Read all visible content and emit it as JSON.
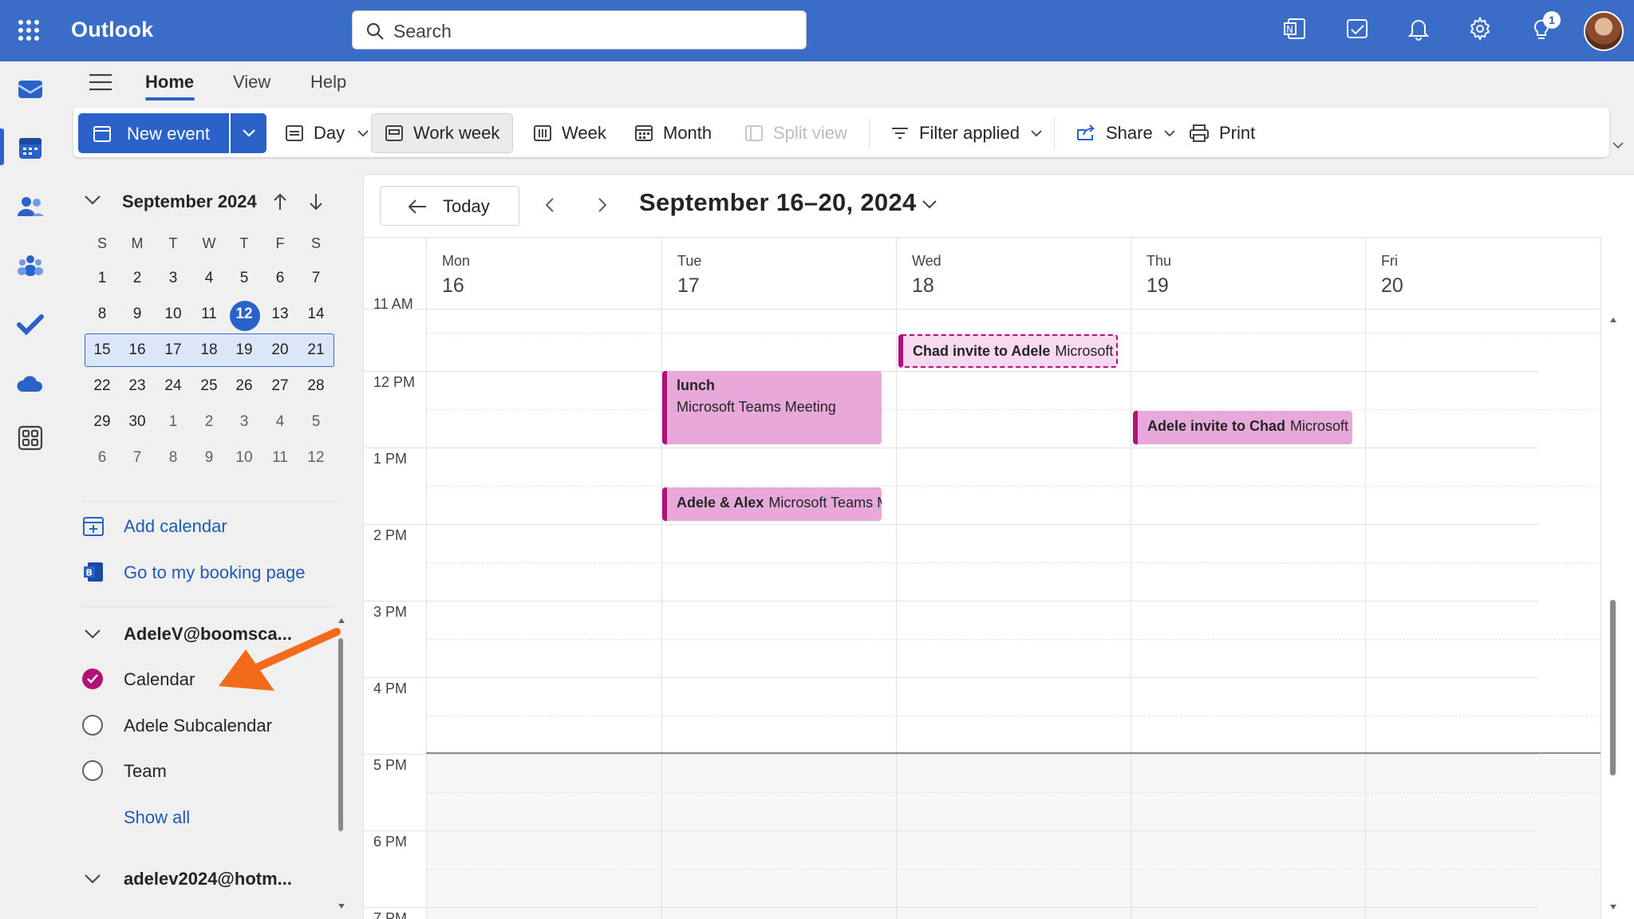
{
  "app": {
    "name": "Outlook"
  },
  "search": {
    "placeholder": "Search"
  },
  "topbar": {
    "notification_count": "1"
  },
  "ribbon": {
    "tabs": [
      {
        "label": "Home",
        "active": true
      },
      {
        "label": "View"
      },
      {
        "label": "Help"
      }
    ],
    "toolbar": {
      "new_event": "New event",
      "day": "Day",
      "work_week": "Work week",
      "week": "Week",
      "month": "Month",
      "split_view": "Split view",
      "filter": "Filter applied",
      "share": "Share",
      "print": "Print"
    }
  },
  "mini_calendar": {
    "title": "September 2024",
    "weekday_headers": [
      "S",
      "M",
      "T",
      "W",
      "T",
      "F",
      "S"
    ],
    "weeks": [
      [
        "1",
        "2",
        "3",
        "4",
        "5",
        "6",
        "7"
      ],
      [
        "8",
        "9",
        "10",
        "11",
        "12",
        "13",
        "14"
      ],
      [
        "15",
        "16",
        "17",
        "18",
        "19",
        "20",
        "21"
      ],
      [
        "22",
        "23",
        "24",
        "25",
        "26",
        "27",
        "28"
      ],
      [
        "29",
        "30",
        "1",
        "2",
        "3",
        "4",
        "5"
      ],
      [
        "6",
        "7",
        "8",
        "9",
        "10",
        "11",
        "12"
      ]
    ],
    "today": "12"
  },
  "sidebar": {
    "add_calendar": "Add calendar",
    "booking_page": "Go to my booking page",
    "account1": "AdeleV@boomsca...",
    "calendars": [
      {
        "label": "Calendar",
        "checked": true
      },
      {
        "label": "Adele Subcalendar",
        "checked": false
      },
      {
        "label": "Team",
        "checked": false
      }
    ],
    "show_all": "Show all",
    "account2": "adelev2024@hotm..."
  },
  "main": {
    "today_label": "Today",
    "date_range": "September 16–20, 2024",
    "days": [
      {
        "name": "Mon",
        "num": "16"
      },
      {
        "name": "Tue",
        "num": "17"
      },
      {
        "name": "Wed",
        "num": "18"
      },
      {
        "name": "Thu",
        "num": "19"
      },
      {
        "name": "Fri",
        "num": "20"
      }
    ],
    "times": [
      "11 AM",
      "12 PM",
      "1 PM",
      "2 PM",
      "3 PM",
      "4 PM",
      "5 PM",
      "6 PM",
      "7 PM"
    ],
    "events": [
      {
        "title": "Chad invite to Adele",
        "detail": "Microsoft Teams Meeting"
      },
      {
        "title": "lunch",
        "detail": "Microsoft Teams Meeting"
      },
      {
        "title": "Adele invite to Chad",
        "detail": "Microsoft Teams Meeting"
      },
      {
        "title": "Adele & Alex",
        "detail": "Microsoft Teams Meeting"
      }
    ]
  },
  "colors": {
    "brand": "#3a6dc7",
    "accent": "#2a62c9",
    "event_bg": "#e6a9da",
    "event_border": "#b0127a",
    "annotation_arrow": "#f26b1d"
  }
}
